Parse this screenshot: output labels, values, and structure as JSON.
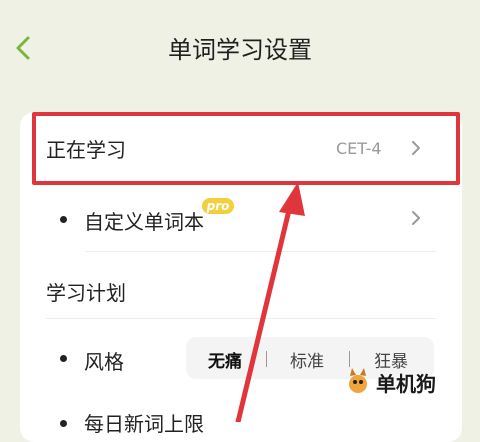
{
  "header": {
    "title": "单词学习设置",
    "back_icon": "chevron-left-icon"
  },
  "rows": {
    "learning": {
      "label": "正在学习",
      "value": "CET-4"
    },
    "custom": {
      "label": "自定义单词本",
      "badge": "pro"
    },
    "plan_heading": {
      "label": "学习计划"
    },
    "style": {
      "label": "风格",
      "options": [
        "无痛",
        "标准",
        "狂暴"
      ],
      "selected": "无痛"
    },
    "daily": {
      "label": "每日新词上限"
    }
  },
  "watermark": {
    "text": "单机狗"
  },
  "colors": {
    "accent": "#7cb342",
    "highlight": "#e0363b",
    "badge": "#f3cf3c",
    "background": "#eef1e4"
  }
}
